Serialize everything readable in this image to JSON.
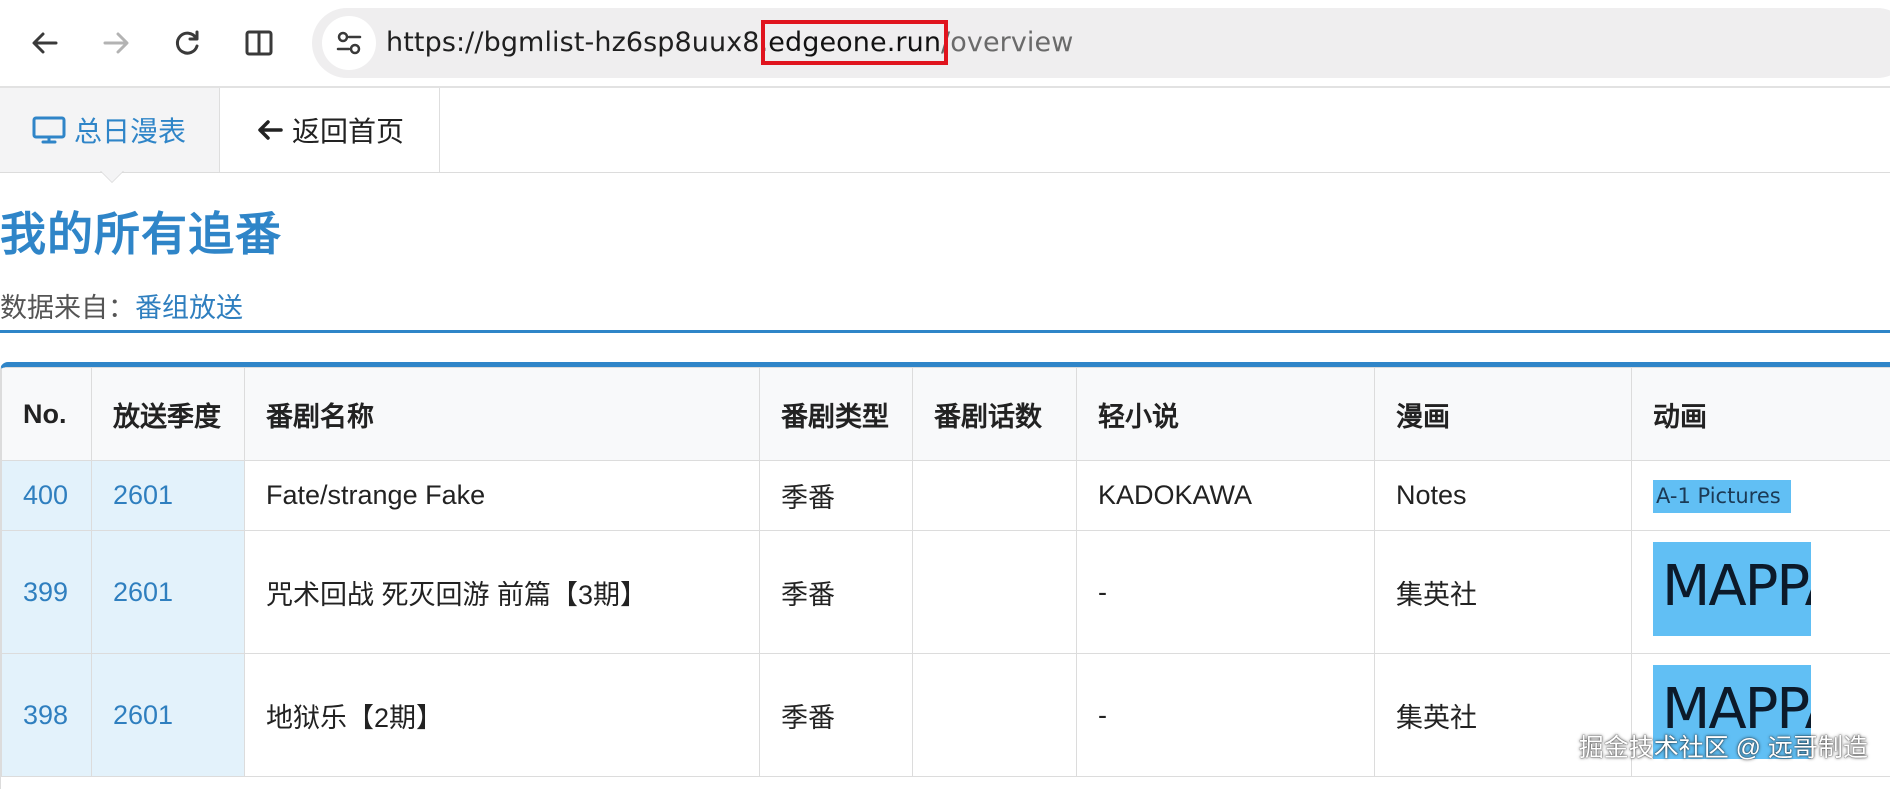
{
  "browser": {
    "url_prefix": "https://bgmlist-hz6sp8uux8.",
    "url_highlight": "edgeone.run",
    "url_suffix": "/overview",
    "highlight_color": "#e0141e"
  },
  "nav": {
    "tabs": [
      {
        "label": "总日漫表",
        "icon": "monitor-icon",
        "active": true
      },
      {
        "label": "返回首页",
        "icon": "arrow-left-icon",
        "active": false
      }
    ]
  },
  "page": {
    "title": "我的所有追番",
    "source_label": "数据来自：",
    "source_link": "番组放送"
  },
  "table": {
    "headers": [
      "No.",
      "放送季度",
      "番剧名称",
      "番剧类型",
      "番剧话数",
      "轻小说",
      "漫画",
      "动画"
    ],
    "rows": [
      {
        "no": "400",
        "season": "2601",
        "name": "Fate/strange Fake",
        "type": "季番",
        "episodes": "",
        "novel": "KADOKAWA",
        "manga": "Notes",
        "anime": "A-1 Pictures",
        "anime_kind": "text"
      },
      {
        "no": "399",
        "season": "2601",
        "name": "咒术回战 死灭回游 前篇【3期】",
        "type": "季番",
        "episodes": "",
        "novel": "-",
        "manga": "集英社",
        "anime": "MAPPA",
        "anime_kind": "logo"
      },
      {
        "no": "398",
        "season": "2601",
        "name": "地狱乐【2期】",
        "type": "季番",
        "episodes": "",
        "novel": "-",
        "manga": "集英社",
        "anime": "MAPPA",
        "anime_kind": "logo"
      }
    ]
  },
  "colors": {
    "accent": "#2f85c8",
    "highlight_cell": "#e3f2fb",
    "studio_bg": "#61bff4"
  },
  "watermark": "掘金技术社区 @ 远哥制造"
}
